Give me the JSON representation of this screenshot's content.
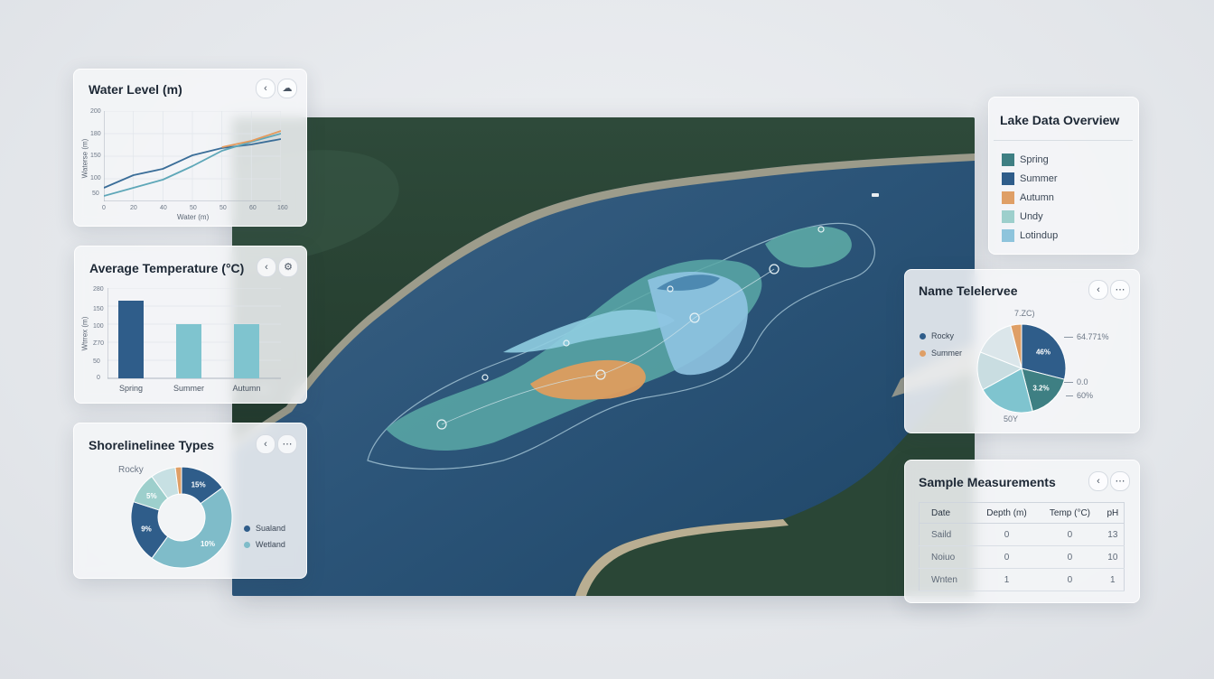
{
  "water_level": {
    "title": "Water Level (m)",
    "y_label": "Waterse (m)",
    "x_label": "Water (m)",
    "y_ticks": [
      "200",
      "180",
      "150",
      "100",
      "50",
      "0"
    ],
    "x_ticks": [
      "0",
      "20",
      "40",
      "50",
      "50",
      "60",
      "160"
    ],
    "back_icon": "chevron-left-icon",
    "menu_icon": "cloud-icon"
  },
  "avg_temp": {
    "title": "Average Temperature (°C)",
    "y_label": "Wtrrex (m)",
    "y_ticks": [
      "280",
      "150",
      "100",
      "Z70",
      "50",
      "0"
    ],
    "back_icon": "chevron-left-icon",
    "menu_icon": "gear-icon"
  },
  "shoreline": {
    "title": "Shorelinelinee Types",
    "outer_label": "Rocky",
    "legend": [
      {
        "label": "Sualand",
        "color": "#2f5d8a"
      },
      {
        "label": "Wetland",
        "color": "#7fbcc9"
      }
    ],
    "back_icon": "chevron-left-icon",
    "menu_icon": "grid-icon"
  },
  "overview": {
    "title": "Lake Data Overview",
    "items": [
      {
        "label": "Spring",
        "color": "#3e7f83"
      },
      {
        "label": "Summer",
        "color": "#2f5d8a"
      },
      {
        "label": "Autumn",
        "color": "#df9f66"
      },
      {
        "label": "Undy",
        "color": "#9dcfcc"
      },
      {
        "label": "Lotindup",
        "color": "#8ec4dc"
      }
    ]
  },
  "telelervee": {
    "title": "Name Telelervee",
    "legend": [
      {
        "label": "Rocky",
        "color": "#2f5d8a"
      },
      {
        "label": "Summer",
        "color": "#df9f66"
      }
    ],
    "top_label": "7.ZC)",
    "callouts": [
      "64.771%",
      "0.0",
      "60%"
    ],
    "bottom_label": "50Y",
    "back_icon": "chevron-left-icon",
    "menu_icon": "grid-icon"
  },
  "samples": {
    "title": "Sample Measurements",
    "columns": [
      "Date",
      "Depth (m)",
      "Temp (°C)",
      "pH"
    ],
    "rows": [
      [
        "Saild",
        "0",
        "0",
        "13"
      ],
      [
        "Noiuo",
        "0",
        "0",
        "10"
      ],
      [
        "Wnten",
        "1",
        "0",
        "1"
      ]
    ],
    "back_icon": "chevron-left-icon",
    "menu_icon": "grid-icon"
  },
  "chart_data": [
    {
      "type": "line",
      "title": "Water Level (m)",
      "xlabel": "Water (m)",
      "ylabel": "Waterse (m)",
      "x": [
        0,
        20,
        40,
        60,
        80,
        100,
        120
      ],
      "series": [
        {
          "color": "#3a6d98",
          "values": [
            30,
            58,
            72,
            102,
            118,
            126,
            138
          ]
        },
        {
          "color": "#5ea7b8",
          "values": [
            12,
            30,
            48,
            78,
            112,
            132,
            150
          ]
        },
        {
          "color": "#e49a5c",
          "values": [
            null,
            null,
            null,
            null,
            120,
            134,
            156
          ]
        }
      ],
      "xlim": [
        0,
        120
      ],
      "ylim": [
        0,
        200
      ]
    },
    {
      "type": "bar",
      "title": "Average Temperature (°C)",
      "categories": [
        "Spring",
        "Summer",
        "Autumn"
      ],
      "values": [
        215,
        150,
        150
      ],
      "colors": [
        "#2f5d8a",
        "#7fc4cf",
        "#7fc4cf"
      ],
      "ylim": [
        0,
        250
      ]
    },
    {
      "type": "pie",
      "title": "Shorelinelinee Types",
      "donut": true,
      "slices": [
        {
          "label": "15%",
          "value": 15,
          "color": "#2f5d8a"
        },
        {
          "label": "10%",
          "value": 45,
          "color": "#7fbcc9"
        },
        {
          "label": "9%",
          "value": 20,
          "color": "#2f5d8a"
        },
        {
          "label": "5%",
          "value": 10,
          "color": "#9dcfcc"
        },
        {
          "label": "",
          "value": 8,
          "color": "#c7e0e3"
        },
        {
          "label": "",
          "value": 2,
          "color": "#df9f66"
        }
      ]
    },
    {
      "type": "pie",
      "title": "Name Telelervee",
      "donut": false,
      "slices": [
        {
          "label": "46%",
          "value": 29,
          "color": "#2f5d8a"
        },
        {
          "label": "3.2%",
          "value": 17,
          "color": "#3e7f83"
        },
        {
          "label": "",
          "value": 21,
          "color": "#7fc4cf"
        },
        {
          "label": "",
          "value": 14,
          "color": "#c9dde1"
        },
        {
          "label": "",
          "value": 15,
          "color": "#dbe6ea"
        },
        {
          "label": "",
          "value": 4,
          "color": "#df9f66"
        }
      ]
    }
  ]
}
